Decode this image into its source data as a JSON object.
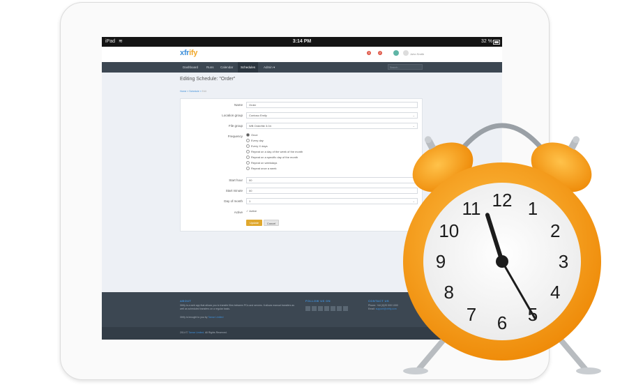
{
  "statusbar": {
    "device": "iPad",
    "time": "3:14 PM",
    "battery": "32 %"
  },
  "header": {
    "logo_main": "xfr",
    "logo_accent": "ify",
    "notif1_count": "3",
    "notif2_count": "2",
    "user_initial": "J",
    "user_name": "John Smith"
  },
  "nav": {
    "items": [
      "Dashboard",
      "Runs",
      "Calendar",
      "Schedules",
      "Admin ▾"
    ],
    "active": "Schedules",
    "search_placeholder": "Search..."
  },
  "page": {
    "title": "Editing Schedule: \"Order\"",
    "breadcrumb": [
      "Home",
      "Schedule",
      "Edit"
    ]
  },
  "form": {
    "name_label": "Name",
    "name_value": "Order",
    "location_label": "Location group",
    "location_value": "Contoso Emily",
    "file_label": "File group",
    "file_value": "WB Orderfile 3.04",
    "frequency_label": "Frequency",
    "frequency_options": [
      "Once",
      "Every day",
      "Every X days",
      "Repeat on a day of the week of the month",
      "Repeat on a specific day of the month",
      "Repeat on weekdays",
      "Repeat once a week"
    ],
    "frequency_selected": "Once",
    "start_hour_label": "Start hour",
    "start_hour_value": "00",
    "start_minute_label": "Start minute",
    "start_minute_value": "00",
    "day_label": "Day of month",
    "day_value": "1",
    "active_label": "Active",
    "active_checkbox_label": "Active",
    "active_checked": true,
    "update_label": "Update",
    "cancel_label": "Cancel"
  },
  "footer": {
    "about_title": "ABOUT",
    "about_text": "Xfrify is a web app that allows you to transfer files between PCs and servers. It allows manual transfers as well as scheduled transfers on a regular basis.",
    "brought_text": "Xfrify is brought to you by",
    "brought_link": "Tamar Limited",
    "follow_title": "FOLLOW US ON",
    "social_icons": [
      "rss-icon",
      "facebook-icon",
      "twitter-icon",
      "google-icon",
      "linkedin-icon",
      "rss-icon",
      "vimeo-icon"
    ],
    "contact_title": "CONTACT US",
    "contact_phone": "Phone: +44 (0)20 000 1000",
    "contact_email_prefix": "Email:",
    "contact_email": "support@xfrify.com",
    "copyright_prefix": "2014 ©",
    "copyright_link": "Tamar Limited",
    "copyright_suffix": ". All Rights Reserved."
  },
  "clock": {
    "numbers": [
      "12",
      "1",
      "2",
      "3",
      "4",
      "5",
      "6",
      "7",
      "8",
      "9",
      "10",
      "11"
    ],
    "hour": 11,
    "minute": 25
  },
  "colors": {
    "brand_blue": "#3f8fd9",
    "brand_orange": "#f0a72a",
    "nav": "#3c4752",
    "update_button": "#e0a82e",
    "alarm_orange": "#f7a01a"
  }
}
